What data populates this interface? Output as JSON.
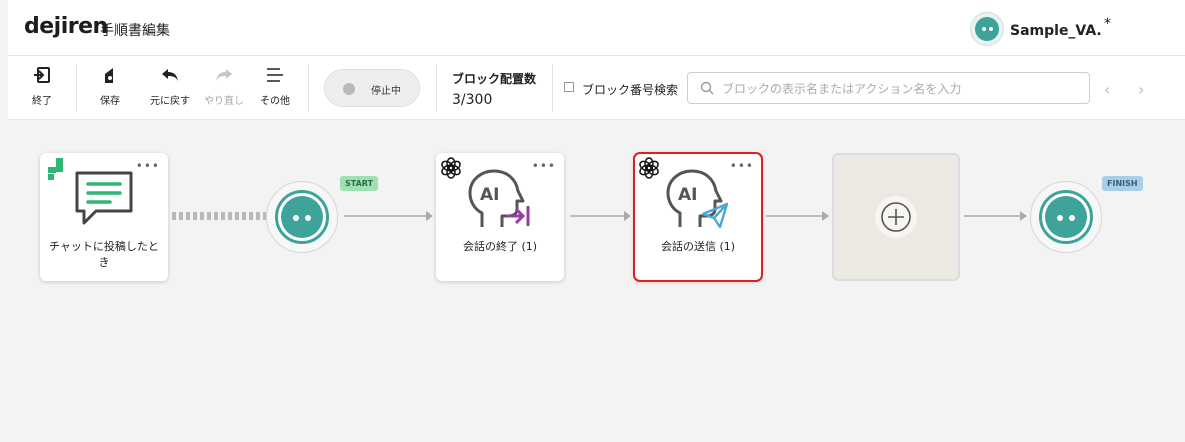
{
  "header": {
    "logo": "dejiren",
    "page_title": "手順書編集",
    "user_name": "Sample_VA.",
    "star": "*"
  },
  "toolbar": {
    "exit_label": "終了",
    "save_label": "保存",
    "undo_label": "元に戻す",
    "redo_label": "やり直し",
    "other_label": "その他",
    "toggle_label": "停止中",
    "block_count_label": "ブロック配置数",
    "block_count_value": "3/300",
    "block_number_search_label": "ブロック番号検索",
    "search_placeholder": "ブロックの表示名またはアクション名を入力"
  },
  "canvas": {
    "trigger_label": "チャットに投稿したとき",
    "start_badge": "START",
    "finish_badge": "FINISH",
    "block1_label": "会話の終了 (1)",
    "block2_label": "会話の送信 (1)",
    "more_glyph": "•••",
    "ai_text": "AI"
  },
  "colors": {
    "accent": "#3ea39b",
    "selected_border": "#e11d1d",
    "start_badge": "#9fe1b5",
    "finish_badge": "#a8cfe6",
    "end_arrow": "#9b3aa5",
    "send_icon": "#4aa7d8"
  },
  "icons": [
    "exit-icon",
    "save-icon",
    "undo-icon",
    "redo-icon",
    "menu-icon",
    "search-icon",
    "chat-icon",
    "openai-icon",
    "ai-head-icon",
    "end-conversation-icon",
    "send-icon",
    "plus-icon"
  ]
}
